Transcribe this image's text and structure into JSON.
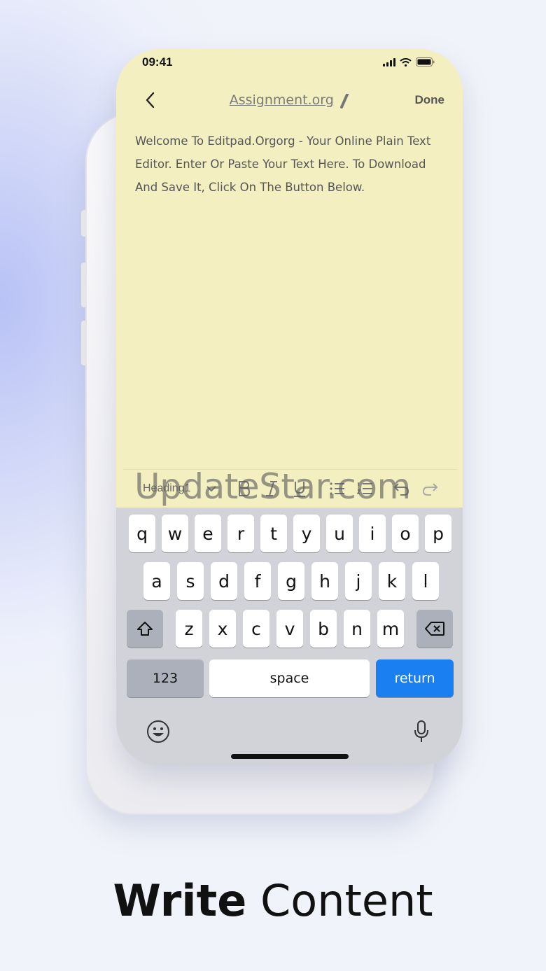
{
  "status_bar": {
    "time": "09:41"
  },
  "note": {
    "title": "Assignment.org",
    "done_label": "Done",
    "body": "Welcome To Editpad.Orgorg - Your Online Plain Text Editor. Enter Or Paste Your Text Here. To Download And Save It, Click On The Button Below."
  },
  "toolbar": {
    "heading_select": "Heading1"
  },
  "watermark": "UpdateStar.com",
  "keyboard": {
    "row1": [
      "q",
      "w",
      "e",
      "r",
      "t",
      "y",
      "u",
      "i",
      "o",
      "p"
    ],
    "row2": [
      "a",
      "s",
      "d",
      "f",
      "g",
      "h",
      "j",
      "k",
      "l"
    ],
    "row3": [
      "z",
      "x",
      "c",
      "v",
      "b",
      "n",
      "m"
    ],
    "numbers_label": "123",
    "space_label": "space",
    "return_label": "return"
  },
  "headline": {
    "bold": "Write",
    "regular": "Content"
  },
  "colors": {
    "note_background": "#f3efc1",
    "return_key": "#1a7ff0",
    "keyboard": "#d1d3d9"
  }
}
